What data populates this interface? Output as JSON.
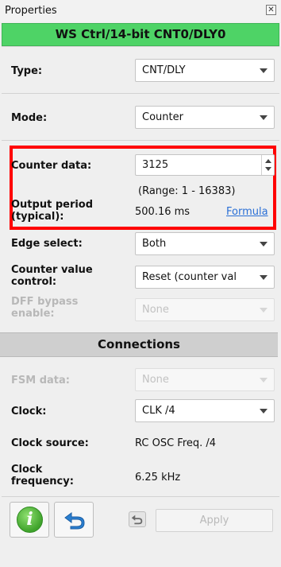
{
  "window": {
    "title": "Properties",
    "close_glyph": "✕"
  },
  "banner": {
    "title": "WS Ctrl/14-bit CNT0/DLY0"
  },
  "fields": {
    "type": {
      "label": "Type:",
      "value": "CNT/DLY"
    },
    "mode": {
      "label": "Mode:",
      "value": "Counter"
    },
    "counter_data": {
      "label": "Counter data:",
      "value": "3125",
      "range": "(Range:  1 - 16383)"
    },
    "output_period": {
      "label_line1": "Output period",
      "label_line2": "(typical):",
      "value": "500.16 ms",
      "link": "Formula"
    },
    "edge_select": {
      "label": "Edge select:",
      "value": "Both"
    },
    "counter_value_control": {
      "label_line1": "Counter value",
      "label_line2": "control:",
      "value": "Reset (counter val"
    },
    "dff_bypass": {
      "label_line1": "DFF bypass",
      "label_line2": "enable:",
      "value": "None"
    }
  },
  "connections": {
    "title": "Connections",
    "fsm_data": {
      "label": "FSM data:",
      "value": "None"
    },
    "clock": {
      "label": "Clock:",
      "value": "CLK /4"
    },
    "clock_source": {
      "label": "Clock source:",
      "value": "RC OSC Freq. /4"
    },
    "clock_frequency": {
      "label_line1": "Clock",
      "label_line2": "frequency:",
      "value": "6.25 kHz"
    }
  },
  "toolbar": {
    "info_glyph": "i",
    "apply_label": "Apply"
  },
  "colors": {
    "banner": "#4ed366",
    "highlight": "#ff0000",
    "link": "#2a6fd6",
    "info_icon": "#3fa32b",
    "undo_icon": "#2a7fd0"
  }
}
